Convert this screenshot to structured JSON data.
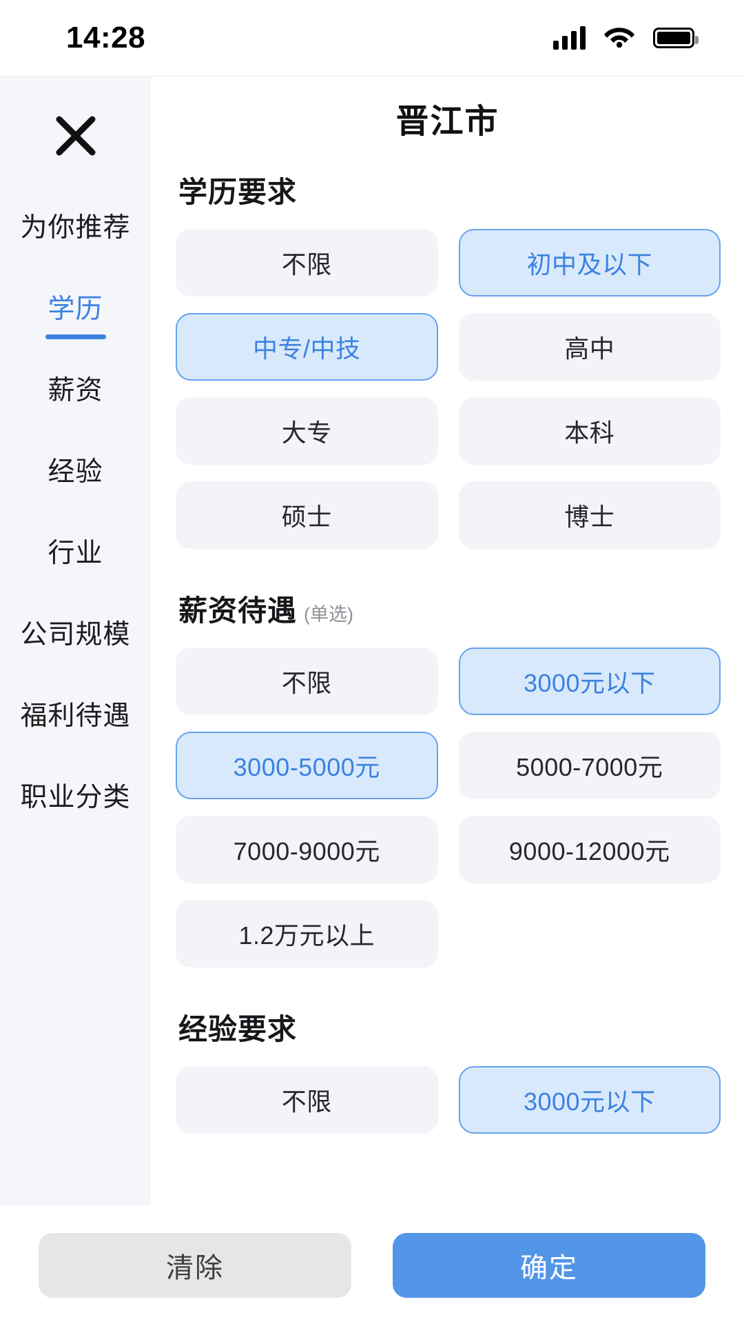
{
  "status_bar": {
    "time": "14:28",
    "signal_icon": "signal-bars-icon",
    "wifi_icon": "wifi-icon",
    "battery_icon": "battery-full-icon"
  },
  "sidebar": {
    "close_icon": "close-icon",
    "items": [
      {
        "label": "为你推荐",
        "active": false
      },
      {
        "label": "学历",
        "active": true
      },
      {
        "label": "薪资",
        "active": false
      },
      {
        "label": "经验",
        "active": false
      },
      {
        "label": "行业",
        "active": false
      },
      {
        "label": "公司规模",
        "active": false
      },
      {
        "label": "福利待遇",
        "active": false
      },
      {
        "label": "职业分类",
        "active": false
      }
    ]
  },
  "header": {
    "title": "晋江市"
  },
  "sections": [
    {
      "title": "学历要求",
      "note": "",
      "options": [
        {
          "label": "不限",
          "selected": false
        },
        {
          "label": "初中及以下",
          "selected": true
        },
        {
          "label": "中专/中技",
          "selected": true
        },
        {
          "label": "高中",
          "selected": false
        },
        {
          "label": "大专",
          "selected": false
        },
        {
          "label": "本科",
          "selected": false
        },
        {
          "label": "硕士",
          "selected": false
        },
        {
          "label": "博士",
          "selected": false
        }
      ]
    },
    {
      "title": "薪资待遇",
      "note": "(单选)",
      "options": [
        {
          "label": "不限",
          "selected": false
        },
        {
          "label": "3000元以下",
          "selected": true
        },
        {
          "label": "3000-5000元",
          "selected": true
        },
        {
          "label": "5000-7000元",
          "selected": false
        },
        {
          "label": "7000-9000元",
          "selected": false
        },
        {
          "label": "9000-12000元",
          "selected": false
        },
        {
          "label": "1.2万元以上",
          "selected": false
        }
      ]
    },
    {
      "title": "经验要求",
      "note": "",
      "options": [
        {
          "label": "不限",
          "selected": false
        },
        {
          "label": "3000元以下",
          "selected": true
        }
      ]
    }
  ],
  "bottom_bar": {
    "clear_label": "清除",
    "confirm_label": "确定"
  },
  "colors": {
    "accent": "#3b82e0",
    "confirm_button": "#5396e8",
    "chip_selected_bg": "#d9e9fc",
    "chip_selected_border": "#64a2ee",
    "chip_bg": "#f2f4f8",
    "sidebar_bg": "#f4f6fa"
  }
}
